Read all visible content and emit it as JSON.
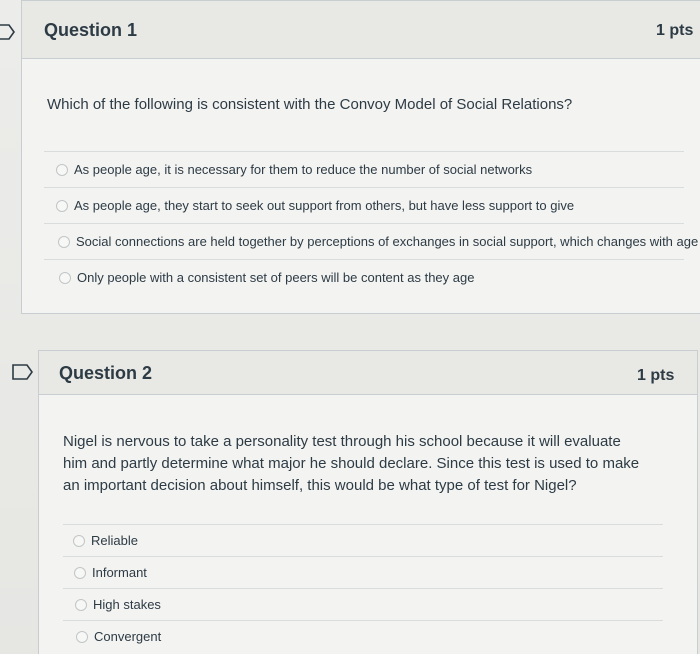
{
  "questions": [
    {
      "title": "Question 1",
      "points": "1 pts",
      "text": "Which of the following is consistent with the Convoy Model of Social Relations?",
      "answers": [
        "As people age, it is necessary for them to reduce the number of social networks",
        "As people age, they start to seek out support from others, but have less support to give",
        "Social connections are held together by perceptions of exchanges in social support, which changes with age",
        "Only people with a consistent set of peers will be content as they age"
      ]
    },
    {
      "title": "Question 2",
      "points": "1 pts",
      "text": "Nigel is nervous to take a personality test through his school because it will evaluate him and partly determine what major he should declare. Since this test is used to make an important decision about himself, this would be what type of test for Nigel?",
      "answers": [
        "Reliable",
        "Informant",
        "High stakes",
        "Convergent"
      ]
    }
  ],
  "icons": {
    "flag": "bookmark-flag-icon"
  },
  "colors": {
    "text": "#2d3b45",
    "border": "#c7cdd1",
    "header_bg": "#e8e8e5"
  }
}
